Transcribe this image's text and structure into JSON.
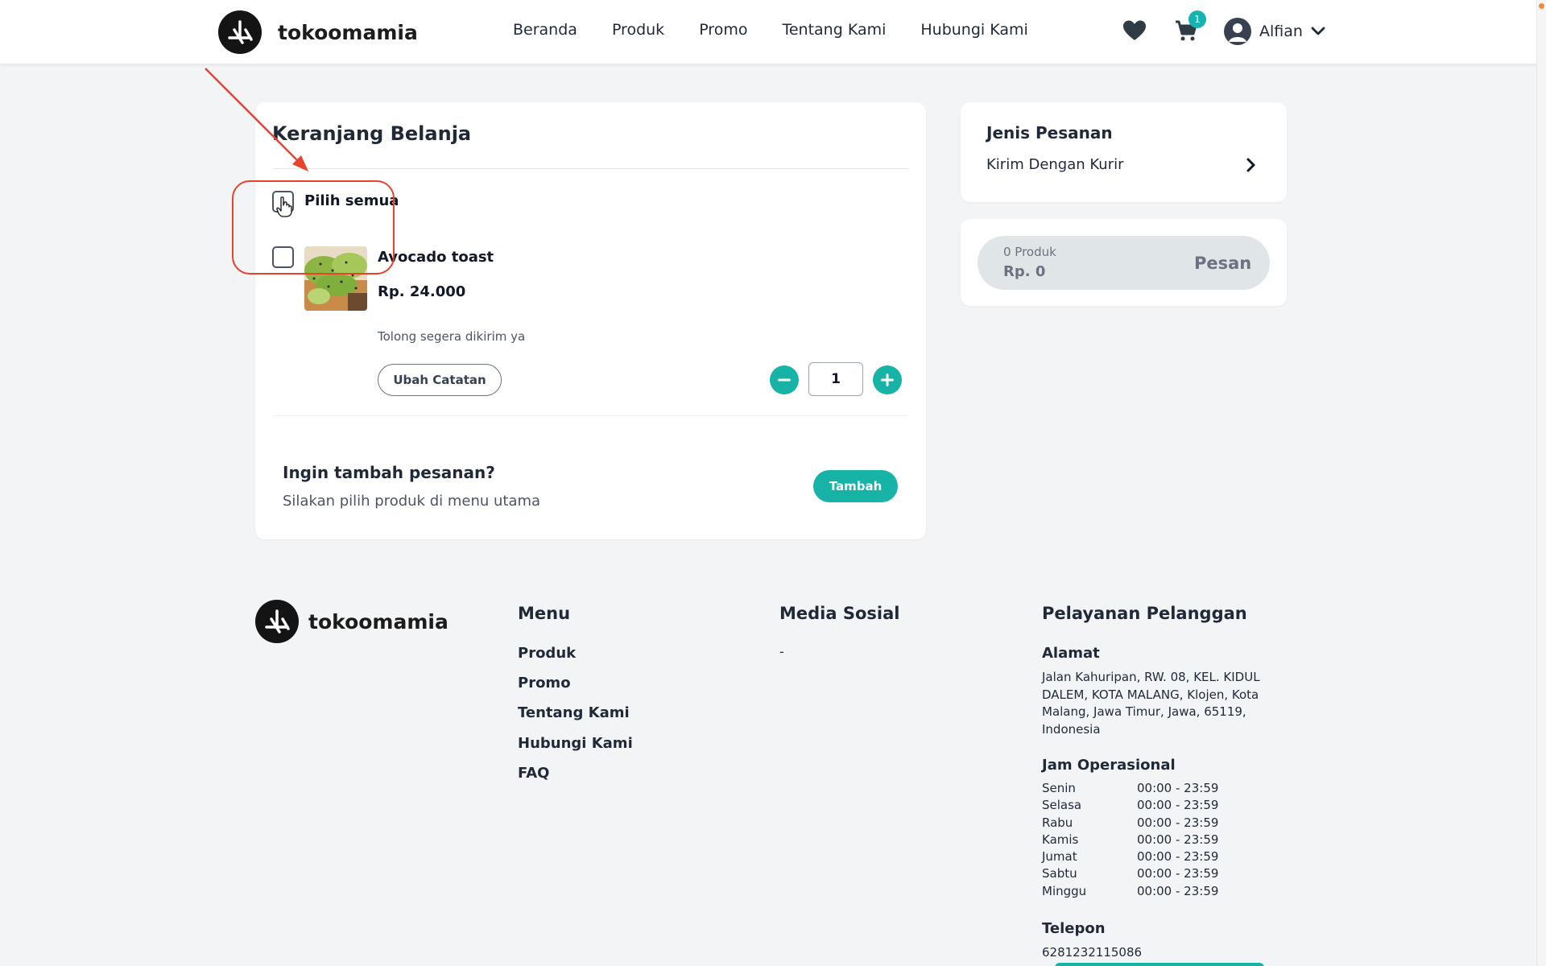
{
  "brand": {
    "name": "tokoomamia"
  },
  "nav": {
    "items": [
      "Beranda",
      "Produk",
      "Promo",
      "Tentang Kami",
      "Hubungi Kami"
    ]
  },
  "header": {
    "cart_count": "1",
    "user_name": "Alfian"
  },
  "cart": {
    "title": "Keranjang Belanja",
    "select_all_label": "Pilih semua",
    "item": {
      "name": "Avocado toast",
      "price": "Rp. 24.000",
      "note": "Tolong segera dikirim ya",
      "edit_note_label": "Ubah Catatan",
      "quantity": "1"
    },
    "add_more": {
      "title": "Ingin tambah pesanan?",
      "subtitle": "Silakan pilih produk di menu utama",
      "button_label": "Tambah"
    }
  },
  "order_type": {
    "title": "Jenis Pesanan",
    "value": "Kirim Dengan Kurir"
  },
  "summary": {
    "count": "0 Produk",
    "total": "Rp. 0",
    "button_label": "Pesan"
  },
  "footer": {
    "menu_title": "Menu",
    "menu_links": [
      "Produk",
      "Promo",
      "Tentang Kami",
      "Hubungi Kami",
      "FAQ"
    ],
    "social_title": "Media Sosial",
    "social_value": "-",
    "service_title": "Pelayanan Pelanggan",
    "address_title": "Alamat",
    "address": "Jalan Kahuripan, RW. 08, KEL. KIDUL DALEM, KOTA MALANG, Klojen, Kota Malang, Jawa Timur, Jawa, 65119, Indonesia",
    "hours_title": "Jam Operasional",
    "hours": [
      {
        "day": "Senin",
        "time": "00:00 - 23:59"
      },
      {
        "day": "Selasa",
        "time": "00:00 - 23:59"
      },
      {
        "day": "Rabu",
        "time": "00:00 - 23:59"
      },
      {
        "day": "Kamis",
        "time": "00:00 - 23:59"
      },
      {
        "day": "Jumat",
        "time": "00:00 - 23:59"
      },
      {
        "day": "Sabtu",
        "time": "00:00 - 23:59"
      },
      {
        "day": "Minggu",
        "time": "00:00 - 23:59"
      }
    ],
    "phone_title": "Telepon",
    "phone": "6281232115086"
  },
  "colors": {
    "accent": "#17b3a6",
    "annotation": "#e8412c"
  },
  "icons": {
    "wishlist": "heart-icon",
    "cart": "cart-icon",
    "user": "user-avatar-icon",
    "dropdown": "chevron-down-icon",
    "order_type": "chevron-right-icon",
    "qty_minus": "minus-icon",
    "qty_plus": "plus-icon",
    "pointer": "hand-cursor-icon"
  }
}
